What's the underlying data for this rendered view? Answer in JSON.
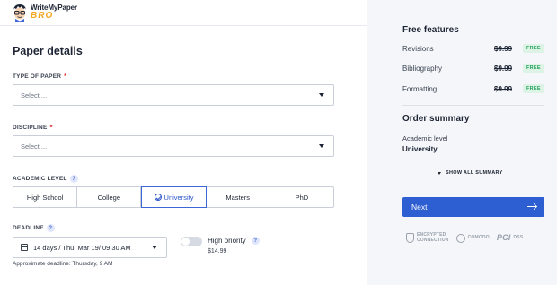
{
  "brand": {
    "line1": "WriteMyPaper",
    "line2": "BRO"
  },
  "form": {
    "title": "Paper details",
    "type_of_paper": {
      "label": "TYPE OF PAPER",
      "required_mark": "*",
      "placeholder": "Select ..."
    },
    "discipline": {
      "label": "DISCIPLINE",
      "required_mark": "*",
      "placeholder": "Select ..."
    },
    "academic_level": {
      "label": "ACADEMIC LEVEL",
      "help": "?",
      "options": [
        "High School",
        "College",
        "University",
        "Masters",
        "PhD"
      ],
      "selected": "University"
    },
    "deadline": {
      "label": "DEADLINE",
      "help": "?",
      "value": "14 days / Thu, Mar 19/ 09:30 AM",
      "approx": "Approximate deadline: Thursday, 9 AM"
    },
    "high_priority": {
      "label": "High priority",
      "help": "?",
      "price": "$14.99",
      "enabled": false
    }
  },
  "sidebar": {
    "features_title": "Free features",
    "features": [
      {
        "name": "Revisions",
        "price": "$9.99",
        "badge": "FREE"
      },
      {
        "name": "Bibliography",
        "price": "$9.99",
        "badge": "FREE"
      },
      {
        "name": "Formatting",
        "price": "$9.99",
        "badge": "FREE"
      }
    ],
    "summary_title": "Order summary",
    "summary_label": "Academic level",
    "summary_value": "University",
    "show_all": "SHOW ALL SUMMARY",
    "next_label": "Next",
    "badges": {
      "encrypted_line1": "ENCRYPTED",
      "encrypted_line2": "CONNECTION",
      "comodo": "COMODO",
      "pci": "PCI",
      "dss": "DSS"
    }
  },
  "colors": {
    "accent": "#2d5fd3",
    "required": "#e0373b",
    "free_badge": "#21a15a",
    "sidebar_bg": "#f4f6f9"
  }
}
